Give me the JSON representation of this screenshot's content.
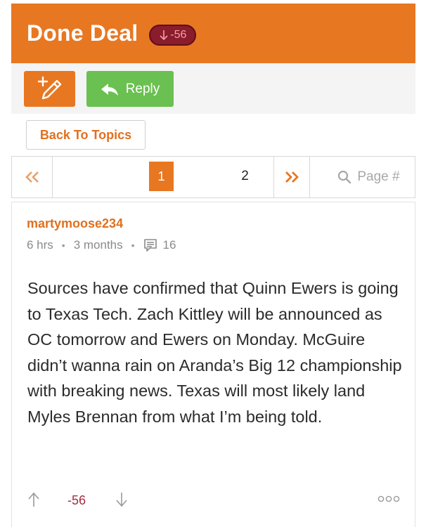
{
  "header": {
    "title": "Done Deal",
    "vote_badge": "-56",
    "colors": {
      "brand": "#e87722",
      "badge": "#8a1c2c"
    }
  },
  "toolbar": {
    "new_topic_icon": "pencil-plus-icon",
    "reply_label": "Reply",
    "reply_icon": "reply-arrow-icon",
    "reply_color": "#6ac050"
  },
  "back_button": {
    "label": "Back To Topics"
  },
  "pagination": {
    "first_icon": "double-chevron-left-icon",
    "pages": [
      "1",
      "2"
    ],
    "current_page": "1",
    "next_icon": "double-chevron-right-icon",
    "search_placeholder": "Page #"
  },
  "post": {
    "author": "martymoose234",
    "time": "6 hrs",
    "age": "3 months",
    "comment_count": "16",
    "body": "Sources have confirmed that Quinn Ewers is going to Texas Tech. Zach Kittley will be announced as OC tomorrow and Ewers on Monday. McGuire didn’t wanna rain on Aranda’s Big 12 championship with breaking news. Texas will most likely land Myles Brennan from what I’m being told.",
    "score": "-56"
  }
}
